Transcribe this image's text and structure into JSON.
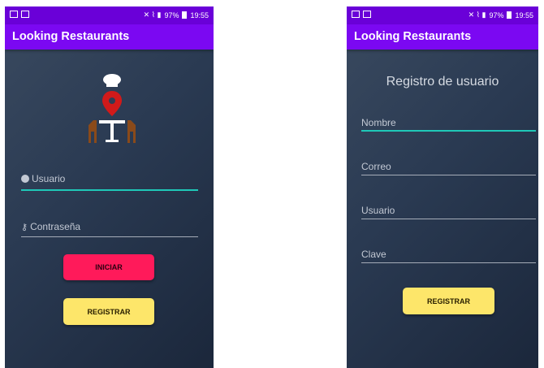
{
  "status_bar": {
    "signal_text": "97%",
    "time": "19:55"
  },
  "app_bar": {
    "title": "Looking Restaurants"
  },
  "login": {
    "username_placeholder": "Usuario",
    "password_placeholder": "Contraseña",
    "login_button": "INICIAR",
    "register_button": "REGISTRAR"
  },
  "register": {
    "title": "Registro de usuario",
    "name_placeholder": "Nombre",
    "email_placeholder": "Correo",
    "user_placeholder": "Usuario",
    "password_placeholder": "Clave",
    "register_button": "REGISTRAR"
  },
  "colors": {
    "status_bar": "#6a00d8",
    "app_bar": "#7b08f2",
    "accent_underline": "#1fc8b8",
    "login_button": "#ff1a5a",
    "register_button": "#fde66a",
    "background": "#2a3a52"
  }
}
